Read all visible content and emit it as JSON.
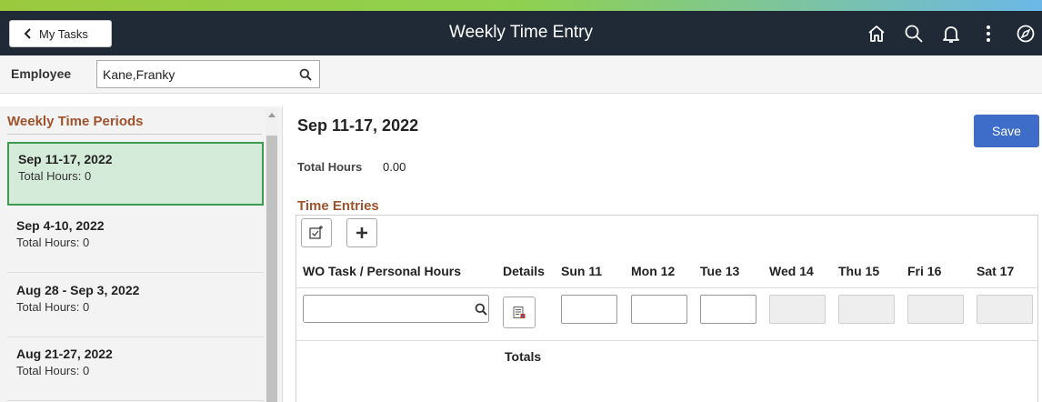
{
  "header": {
    "back_label": "My Tasks",
    "title": "Weekly Time Entry",
    "icons": [
      "home-icon",
      "search-icon",
      "bell-icon",
      "more-icon",
      "navbar-icon"
    ]
  },
  "employee": {
    "label": "Employee",
    "value": "Kane,Franky"
  },
  "sidebar": {
    "header": "Weekly Time Periods",
    "periods": [
      {
        "date": "Sep 11-17, 2022",
        "hours": "Total Hours: 0",
        "selected": true
      },
      {
        "date": "Sep 4-10, 2022",
        "hours": "Total Hours: 0",
        "selected": false
      },
      {
        "date": "Aug 28 - Sep 3, 2022",
        "hours": "Total Hours: 0",
        "selected": false
      },
      {
        "date": "Aug 21-27, 2022",
        "hours": "Total Hours: 0",
        "selected": false
      }
    ]
  },
  "main": {
    "title": "Sep 11-17, 2022",
    "save_label": "Save",
    "total_hours_label": "Total Hours",
    "total_hours_value": "0.00",
    "entries_header": "Time Entries",
    "columns": [
      "WO Task / Personal Hours",
      "Details",
      "Sun 11",
      "Mon 12",
      "Tue 13",
      "Wed 14",
      "Thu 15",
      "Fri 16",
      "Sat 17"
    ],
    "totals_label": "Totals"
  },
  "colors": {
    "topbar": "#1f2a36",
    "accent_heading": "#a0522d",
    "selected_period": "#d5ebd9",
    "selected_border": "#3b9c4f",
    "save_button": "#3d6cc9"
  }
}
